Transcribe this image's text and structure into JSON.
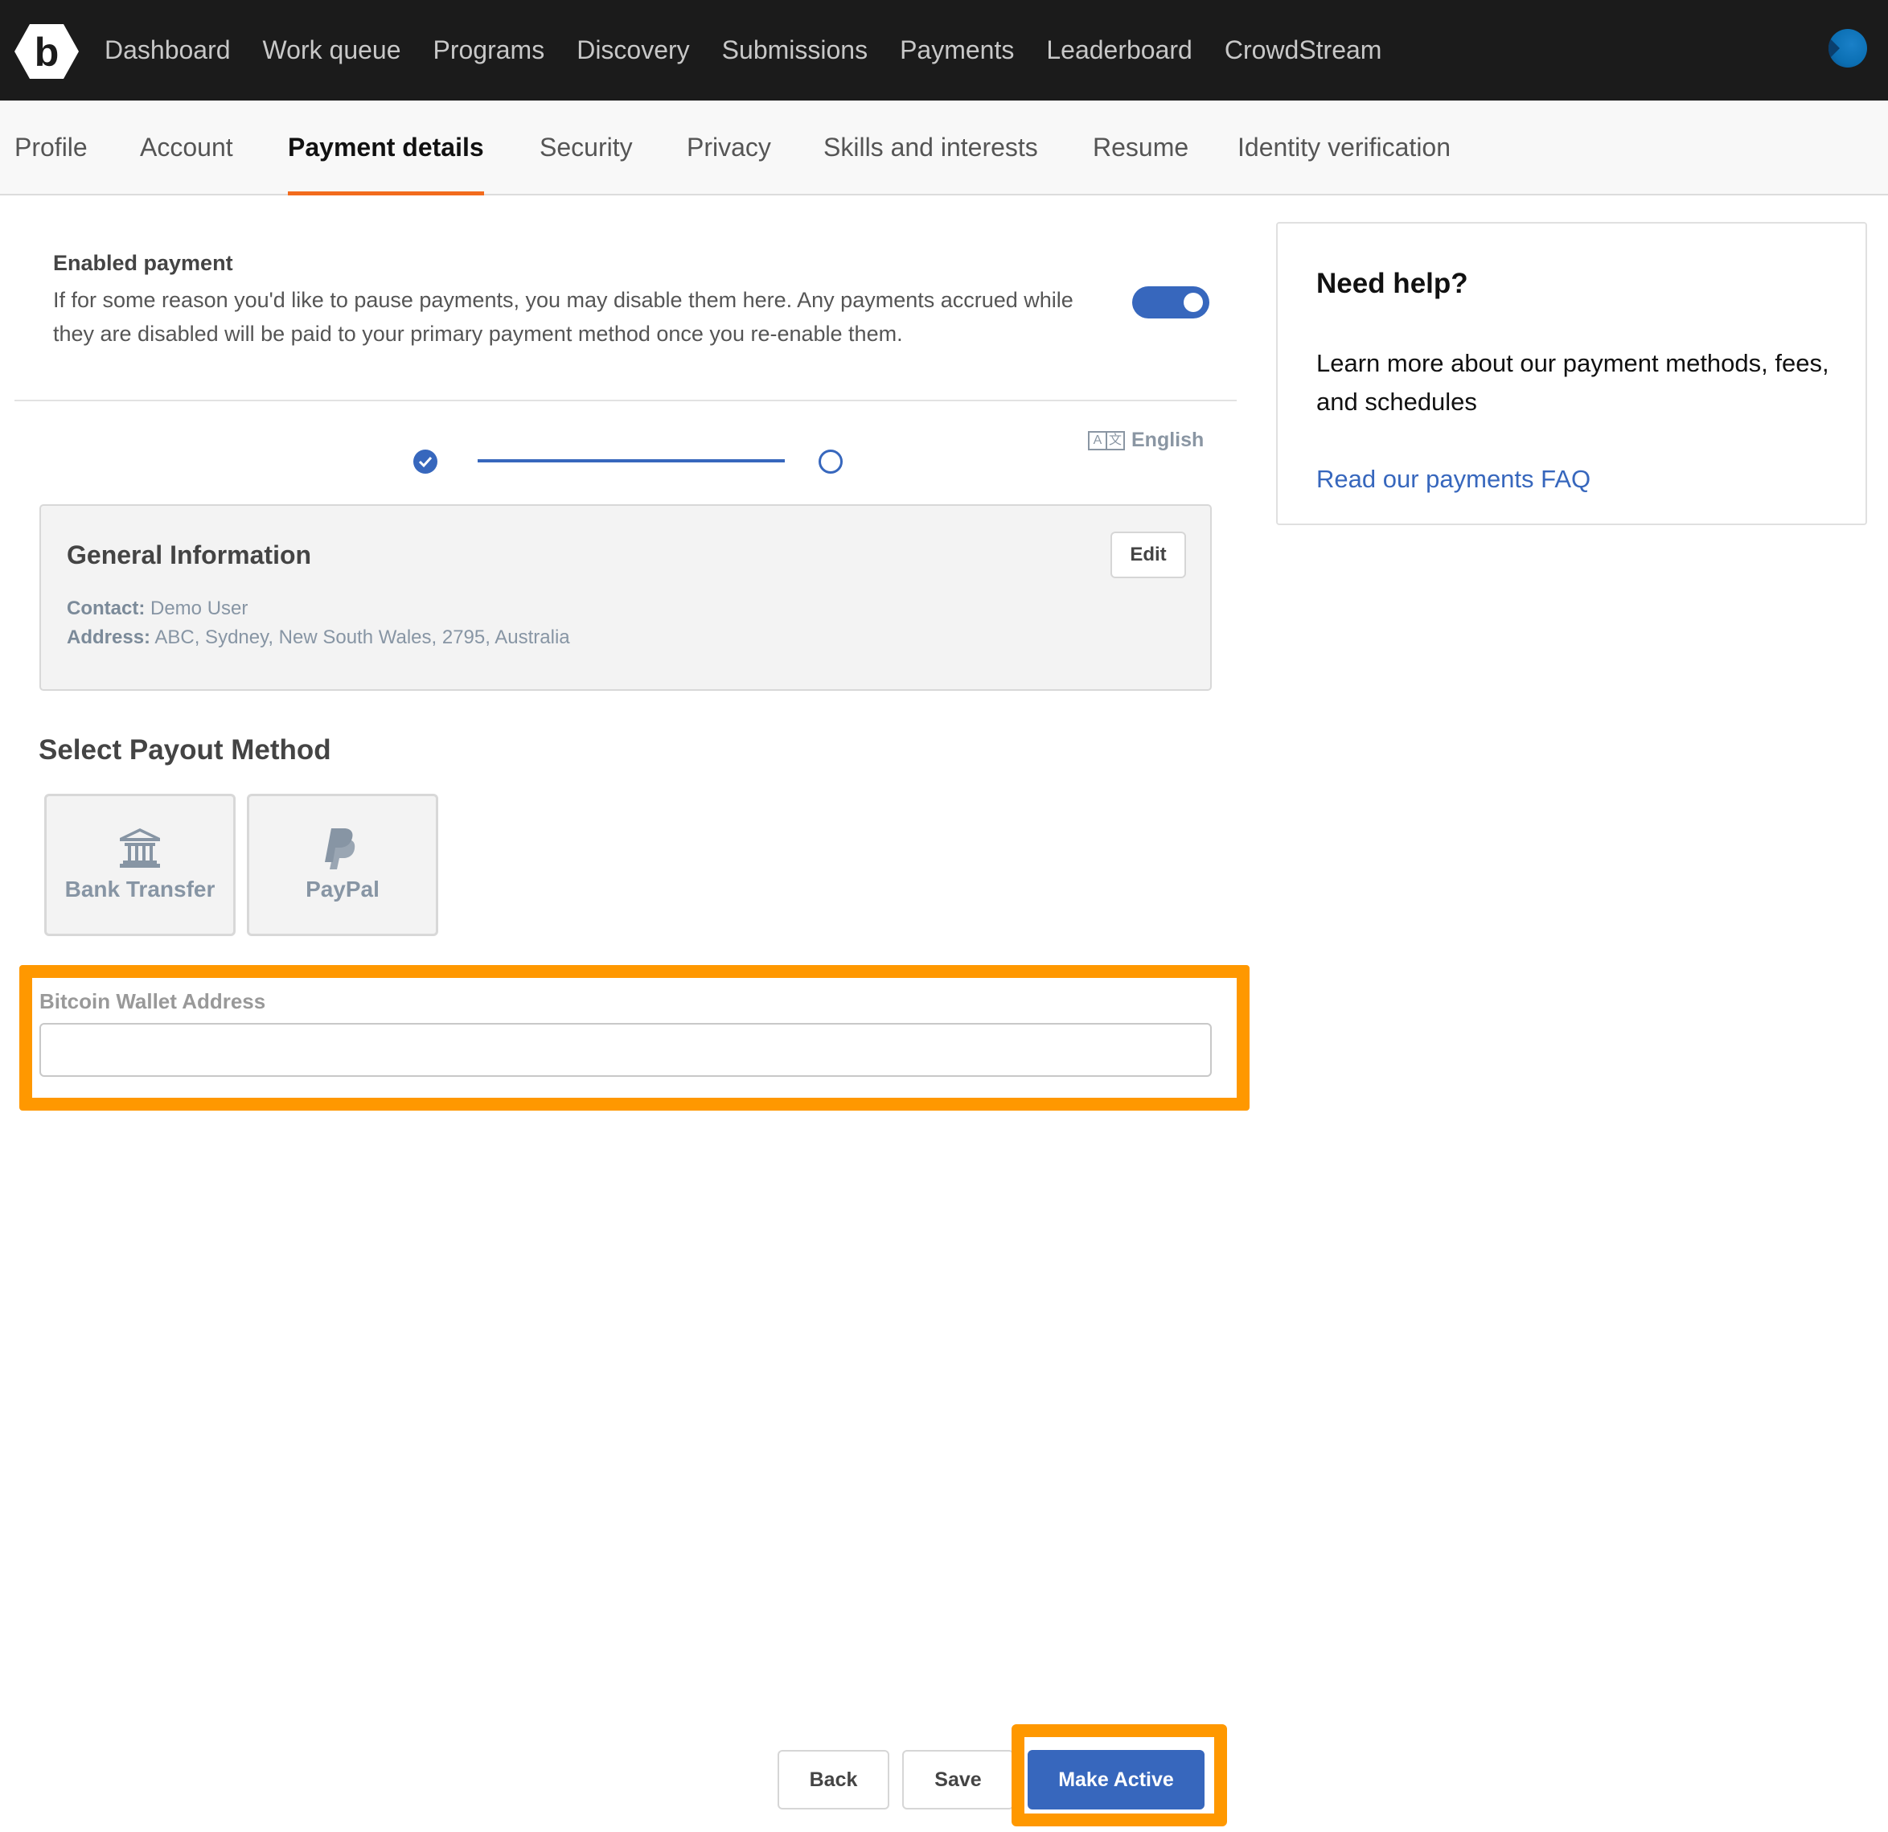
{
  "topnav": {
    "logo_letter": "b",
    "items": [
      "Dashboard",
      "Work queue",
      "Programs",
      "Discovery",
      "Submissions",
      "Payments",
      "Leaderboard",
      "CrowdStream"
    ]
  },
  "tabs": {
    "items": [
      "Profile",
      "Account",
      "Payment details",
      "Security",
      "Privacy",
      "Skills and interests",
      "Resume",
      "Identity verification"
    ],
    "active": "Payment details"
  },
  "enabled_payment": {
    "title": "Enabled payment",
    "description": "If for some reason you'd like to pause payments, you may disable them here. Any payments accrued while they are disabled will be paid to your primary payment method once you re-enable them.",
    "enabled": true
  },
  "stepper": {
    "steps_total": 2,
    "current_step": 2,
    "completed_steps": 1
  },
  "language": {
    "icon": "translate-icon",
    "icon_glyphs": [
      "A",
      "文"
    ],
    "label": "English"
  },
  "general_info": {
    "title": "General Information",
    "edit_label": "Edit",
    "contact_label": "Contact:",
    "contact_value": "Demo User",
    "address_label": "Address:",
    "address_value": "ABC, Sydney, New South Wales, 2795, Australia"
  },
  "payout": {
    "title": "Select Payout Method",
    "methods": [
      {
        "label": "Bank Transfer",
        "icon": "bank-icon"
      },
      {
        "label": "PayPal",
        "icon": "paypal-icon"
      }
    ]
  },
  "bitcoin": {
    "label": "Bitcoin Wallet Address",
    "value": "",
    "placeholder": ""
  },
  "actions": {
    "back": "Back",
    "save": "Save",
    "make_active": "Make Active"
  },
  "help": {
    "title": "Need help?",
    "text": "Learn more about our payment methods, fees, and schedules",
    "link": "Read our payments FAQ"
  },
  "colors": {
    "primary": "#3767bd",
    "tab_underline": "#f26b1d",
    "highlight": "#ff9800",
    "nav_bg": "#1b1b1b"
  }
}
